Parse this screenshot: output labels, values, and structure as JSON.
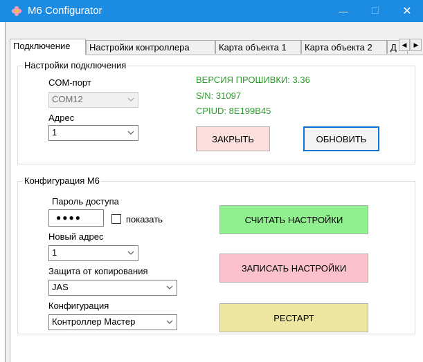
{
  "window": {
    "title": "M6 Configurator",
    "minimize_glyph": "—",
    "maximize_glyph": "□",
    "close_glyph": "✕"
  },
  "tabs": [
    {
      "label": "Подключение",
      "active": true
    },
    {
      "label": "Настройки контроллера",
      "active": false
    },
    {
      "label": "Карта объекта 1",
      "active": false
    },
    {
      "label": "Карта объекта 2",
      "active": false
    },
    {
      "label": "Д",
      "active": false
    }
  ],
  "tab_scroll": {
    "left": "◀",
    "right": "▶"
  },
  "connection": {
    "group_title": "Настройки подключения",
    "com_label": "COM-порт",
    "com_value": "COM12",
    "address_label": "Адрес",
    "address_value": "1",
    "firmware": "ВЕРСИЯ ПРОШИВКИ: 3.36",
    "serial": "S/N: 31097",
    "cpiud": "CPIUD: 8E199B45",
    "close_button": "ЗАКРЫТЬ",
    "refresh_button": "ОБНОВИТЬ"
  },
  "config": {
    "group_title": "Конфигурация М6",
    "password_label": "Пароль доступа",
    "password_value": "●●●●",
    "show_label": "показать",
    "new_address_label": "Новый адрес",
    "new_address_value": "1",
    "copy_protection_label": "Защита от копирования",
    "copy_protection_value": "JAS",
    "configuration_label": "Конфигурация",
    "configuration_value": "Контроллер Мастер",
    "read_button": "СЧИТАТЬ НАСТРОЙКИ",
    "write_button": "ЗАПИСАТЬ НАСТРОЙКИ",
    "restart_button": "РЕСТАРТ"
  },
  "colors": {
    "titlebar": "#1c8ce3",
    "status_green": "#2c9a2c",
    "close_btn": "#fbdfdc",
    "read_btn": "#90f090",
    "write_btn": "#fbc2cc",
    "restart_btn": "#ece6a0",
    "focus_border": "#0a72d2"
  },
  "icons": {
    "app": "flower-icon",
    "dropdown": "chevron-down-icon"
  }
}
